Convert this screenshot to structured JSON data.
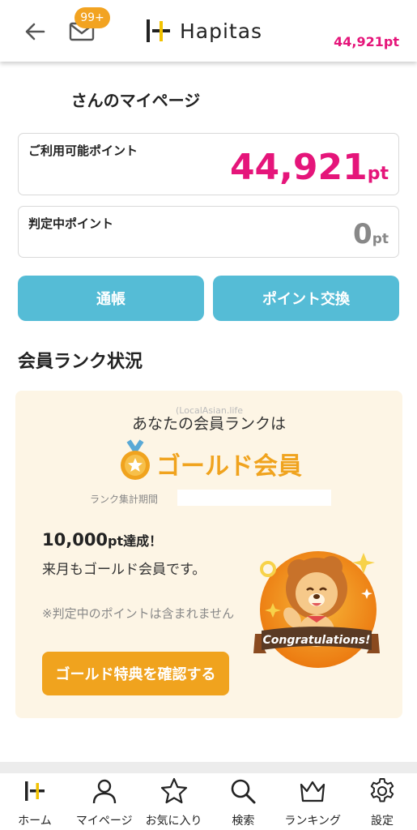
{
  "header": {
    "badge_count": "99+",
    "logo_text": "Hapitas",
    "points": "44,921pt"
  },
  "page": {
    "title": "さんのマイページ"
  },
  "points": {
    "available_label": "ご利用可能ポイント",
    "available_value": "44,921",
    "available_unit": "pt",
    "pending_label": "判定中ポイント",
    "pending_value": "0",
    "pending_unit": "pt"
  },
  "buttons": {
    "passbook": "通帳",
    "exchange": "ポイント交換"
  },
  "rank": {
    "section_title": "会員ランク状況",
    "watermark": "(LocalAsian.life",
    "intro": "あなたの会員ランクは",
    "rank_name": "ゴールド会員",
    "period_label": "ランク集計期間",
    "achieved_amount": "10,000",
    "achieved_unit": "pt",
    "achieved_suffix": "達成！",
    "next_month": "来月もゴールド会員です。",
    "note": "※判定中のポイントは含まれません",
    "benefit_button": "ゴールド特典を確認する",
    "congrats": "Congratulations!"
  },
  "nav": [
    {
      "label": "ホーム",
      "icon": "home-logo-icon"
    },
    {
      "label": "マイページ",
      "icon": "person-icon"
    },
    {
      "label": "お気に入り",
      "icon": "star-icon"
    },
    {
      "label": "検索",
      "icon": "search-icon"
    },
    {
      "label": "ランキング",
      "icon": "crown-icon"
    },
    {
      "label": "設定",
      "icon": "gear-icon"
    }
  ],
  "colors": {
    "accent_pink": "#e5157a",
    "button_blue": "#55bcd6",
    "gold": "#f0a31e",
    "rank_bg": "#fdf5e5"
  }
}
